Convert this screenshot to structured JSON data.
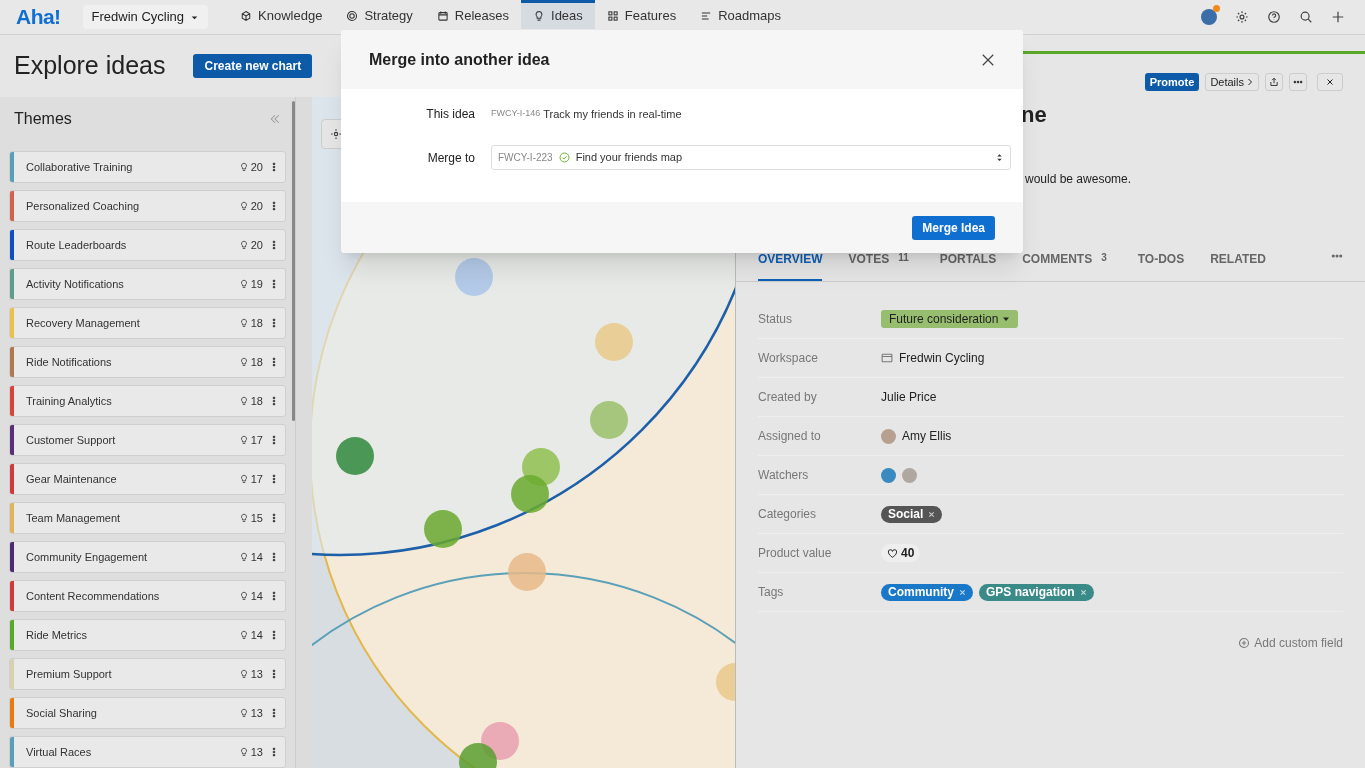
{
  "app": {
    "logo": "Aha!",
    "workspace": "Fredwin Cycling"
  },
  "nav": [
    {
      "label": "Knowledge",
      "selected": false
    },
    {
      "label": "Strategy",
      "selected": false
    },
    {
      "label": "Releases",
      "selected": false
    },
    {
      "label": "Ideas",
      "selected": true
    },
    {
      "label": "Features",
      "selected": false
    },
    {
      "label": "Roadmaps",
      "selected": false
    }
  ],
  "page": {
    "title": "Explore ideas",
    "create_button": "Create new chart"
  },
  "sidebar": {
    "title": "Themes",
    "items": [
      {
        "name": "Collaborative Training",
        "count": "20",
        "color": "#5a9fb8"
      },
      {
        "name": "Personalized Coaching",
        "count": "20",
        "color": "#d0624e"
      },
      {
        "name": "Route Leaderboards",
        "count": "20",
        "color": "#0f4fc4"
      },
      {
        "name": "Activity Notifications",
        "count": "19",
        "color": "#5e9c8c"
      },
      {
        "name": "Recovery Management",
        "count": "18",
        "color": "#e8c14a"
      },
      {
        "name": "Ride Notifications",
        "count": "18",
        "color": "#b07850"
      },
      {
        "name": "Training Analytics",
        "count": "18",
        "color": "#d9443a"
      },
      {
        "name": "Customer Support",
        "count": "17",
        "color": "#5c3078"
      },
      {
        "name": "Gear Maintenance",
        "count": "17",
        "color": "#d03a3a"
      },
      {
        "name": "Team Management",
        "count": "15",
        "color": "#e0b45a"
      },
      {
        "name": "Community Engagement",
        "count": "14",
        "color": "#4e2a70"
      },
      {
        "name": "Content Recommendations",
        "count": "14",
        "color": "#d03a3a"
      },
      {
        "name": "Ride Metrics",
        "count": "14",
        "color": "#5aa82a"
      },
      {
        "name": "Premium Support",
        "count": "13",
        "color": "#d8d0b0"
      },
      {
        "name": "Social Sharing",
        "count": "13",
        "color": "#e87a10"
      },
      {
        "name": "Virtual Races",
        "count": "13",
        "color": "#5a9fb8"
      }
    ]
  },
  "detail": {
    "toolbar": {
      "promote": "Promote",
      "details": "Details"
    },
    "title_fragment": "ne",
    "description_fragment": "would be awesome.",
    "tabs": [
      {
        "label": "OVERVIEW",
        "selected": true
      },
      {
        "label": "VOTES",
        "count": "11",
        "selected": false
      },
      {
        "label": "PORTALS",
        "selected": false
      },
      {
        "label": "COMMENTS",
        "count": "3",
        "selected": false
      },
      {
        "label": "TO-DOS",
        "selected": false
      },
      {
        "label": "RELATED",
        "selected": false
      }
    ],
    "fields": [
      {
        "label": "Status",
        "kind": "status",
        "value": "Future consideration"
      },
      {
        "label": "Workspace",
        "kind": "workspace",
        "value": "Fredwin Cycling"
      },
      {
        "label": "Created by",
        "kind": "text",
        "value": "Julie Price"
      },
      {
        "label": "Assigned to",
        "kind": "user",
        "value": "Amy Ellis"
      },
      {
        "label": "Watchers",
        "kind": "avatars"
      },
      {
        "label": "Categories",
        "kind": "tags",
        "tags": [
          {
            "label": "Social",
            "color": "#555555"
          }
        ]
      },
      {
        "label": "Product value",
        "kind": "score",
        "value": "40"
      },
      {
        "label": "Tags",
        "kind": "tags",
        "tags": [
          {
            "label": "Community",
            "color": "#1a78c8"
          },
          {
            "label": "GPS navigation",
            "color": "#3a8a88"
          }
        ]
      }
    ],
    "add_field": "Add custom field"
  },
  "modal": {
    "title": "Merge into another idea",
    "this_idea": {
      "label": "This idea",
      "id": "FWCY-I-146",
      "name": "Track my friends in real-time"
    },
    "merge_to": {
      "label": "Merge to",
      "id": "FWCY-I-223",
      "name": "Find your friends map"
    },
    "button": "Merge Idea"
  }
}
